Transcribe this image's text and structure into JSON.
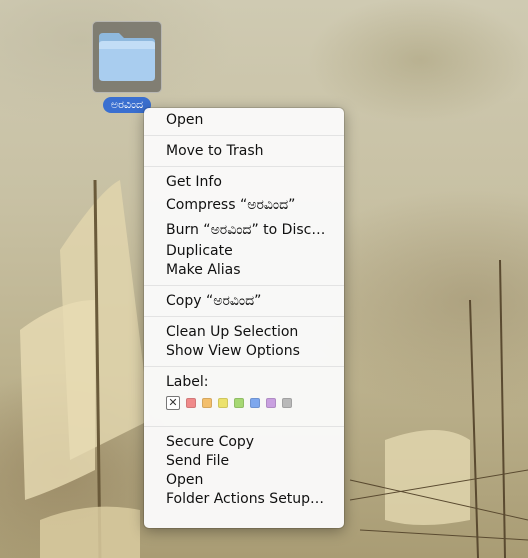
{
  "desktop": {
    "folder_name": "ಅರವಿಂದ"
  },
  "menu": {
    "groups": [
      [
        "Open"
      ],
      [
        "Move to Trash"
      ],
      [
        "Get Info",
        "Compress “ಅರವಿಂದ”",
        "Burn “ಅರವಿಂದ” to Disc…",
        "Duplicate",
        "Make Alias"
      ],
      [
        "Copy “ಅರವಿಂದ”"
      ],
      [
        "Clean Up Selection",
        "Show View Options"
      ]
    ],
    "label_title": "Label:",
    "label_none_glyph": "✕",
    "label_colors": [
      "#f08a8a",
      "#f3bf6c",
      "#ece26c",
      "#a6d873",
      "#7ea8ee",
      "#c9a0e0",
      "#b9b9b9"
    ],
    "last_group": [
      "Secure Copy",
      "Send File",
      "Open",
      "Folder Actions Setup…"
    ]
  }
}
